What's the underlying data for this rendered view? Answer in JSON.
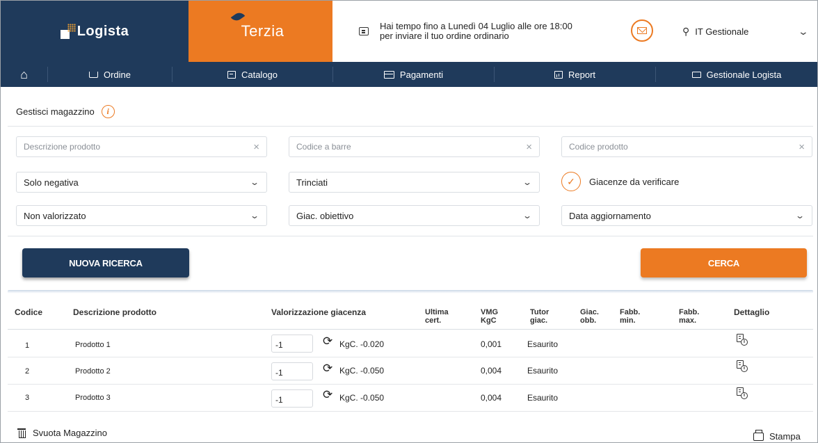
{
  "header": {
    "logo_logista": "Logista",
    "logo_terzia": "Terzia",
    "message_line1": "Hai tempo fino a Lunedì 04 Luglio alle ore 18:00",
    "message_line2": "per inviare il tuo ordine ordinario",
    "user_name": "IT Gestionale"
  },
  "nav": {
    "items": [
      {
        "label": "Ordine",
        "icon": "cart-icon"
      },
      {
        "label": "Catalogo",
        "icon": "document-icon"
      },
      {
        "label": "Pagamenti",
        "icon": "card-icon"
      },
      {
        "label": "Report",
        "icon": "chart-icon"
      },
      {
        "label": "Gestionale Logista",
        "icon": "monitor-icon"
      }
    ]
  },
  "page": {
    "title": "Gestisci magazzino"
  },
  "filters": {
    "descrizione_placeholder": "Descrizione prodotto",
    "codice_barre_placeholder": "Codice a barre",
    "codice_prodotto_placeholder": "Codice prodotto",
    "negativa_value": "Solo negativa",
    "categoria_value": "Trinciati",
    "giacenze_label": "Giacenze da verificare",
    "valorizzato_value": "Non valorizzato",
    "giac_obiettivo_value": "Giac. obiettivo",
    "data_value": "Data aggiornamento"
  },
  "buttons": {
    "nuova_ricerca": "NUOVA RICERCA",
    "cerca": "CERCA"
  },
  "table": {
    "headers": {
      "codice": "Codice",
      "descrizione": "Descrizione prodotto",
      "valorizzazione": "Valorizzazione giacenza",
      "ultima_1": "Ultima",
      "ultima_2": "cert.",
      "vmg_1": "VMG",
      "vmg_2": "KgC",
      "tutor_1": "Tutor",
      "tutor_2": "giac.",
      "giac_1": "Giac.",
      "giac_2": "obb.",
      "fabbmin_1": "Fabb.",
      "fabbmin_2": "min.",
      "fabbmax_1": "Fabb.",
      "fabbmax_2": "max.",
      "dettaglio": "Dettaglio"
    },
    "rows": [
      {
        "codice": "1",
        "descrizione": "Prodotto 1",
        "qty": "-1",
        "kgc": "KgC. -0.020",
        "vmg": "0,001",
        "tutor": "Esaurito"
      },
      {
        "codice": "2",
        "descrizione": "Prodotto 2",
        "qty": "-1",
        "kgc": "KgC. -0.050",
        "vmg": "0,004",
        "tutor": "Esaurito"
      },
      {
        "codice": "3",
        "descrizione": "Prodotto 3",
        "qty": "-1",
        "kgc": "KgC. -0.050",
        "vmg": "0,004",
        "tutor": "Esaurito"
      }
    ]
  },
  "footer": {
    "svuota": "Svuota Magazzino",
    "stampa": "Stampa"
  },
  "colors": {
    "navy": "#1f3a5b",
    "orange": "#ec7a22"
  }
}
